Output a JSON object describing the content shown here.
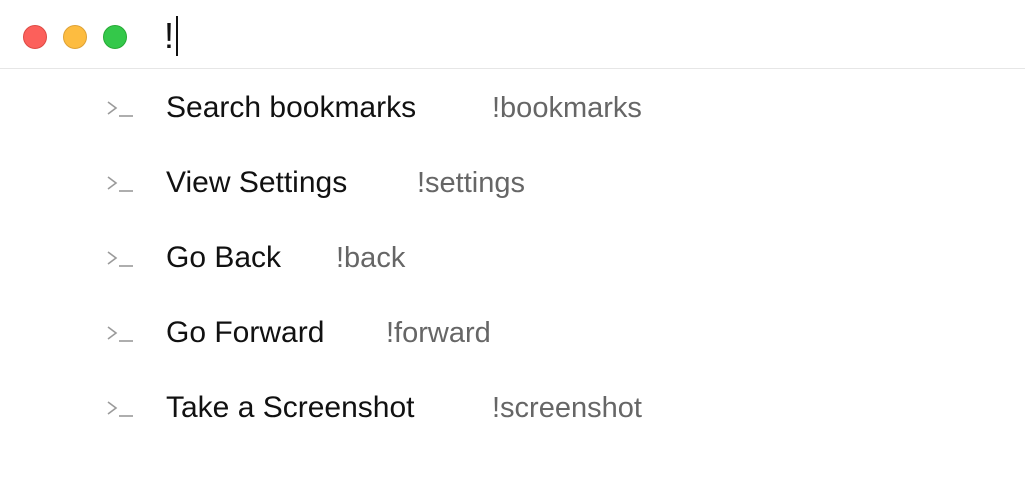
{
  "window": {
    "controls": {
      "close": "close-button",
      "minimize": "minimize-button",
      "zoom": "zoom-button"
    },
    "colors": {
      "close": "#fc605b",
      "minimize": "#fdbc40",
      "zoom": "#34c84a"
    }
  },
  "search": {
    "value": "!"
  },
  "results": [
    {
      "title": "Search bookmarks",
      "command": "!bookmarks",
      "icon": "terminal-prompt-icon"
    },
    {
      "title": "View Settings",
      "command": "!settings",
      "icon": "terminal-prompt-icon"
    },
    {
      "title": "Go Back",
      "command": "!back",
      "icon": "terminal-prompt-icon"
    },
    {
      "title": "Go Forward",
      "command": "!forward",
      "icon": "terminal-prompt-icon"
    },
    {
      "title": "Take a Screenshot",
      "command": "!screenshot",
      "icon": "terminal-prompt-icon"
    }
  ]
}
